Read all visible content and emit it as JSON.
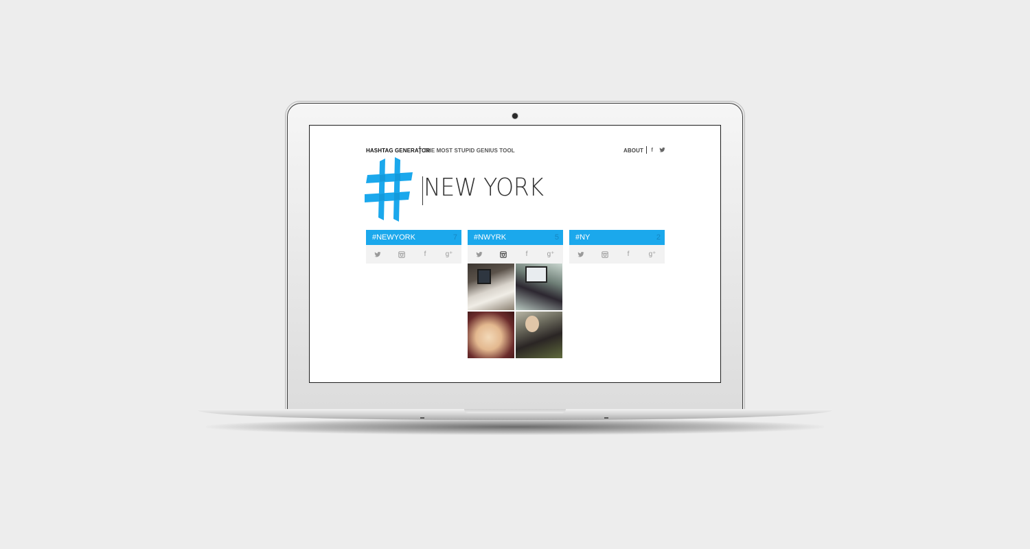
{
  "site": {
    "brand": "HASHTAG GENERATOR",
    "tagline": "THE MOST STUPID GENIUS TOOL",
    "nav": {
      "about": "ABOUT",
      "facebook_glyph": "f",
      "icons": [
        "facebook-icon",
        "twitter-icon"
      ]
    }
  },
  "search": {
    "query": "NEW YORK"
  },
  "colors": {
    "accent": "#1ba8ec",
    "count": "#1487c4",
    "icon_bar": "#f2f2f2"
  },
  "columns": [
    {
      "tag": "#NEWYORK",
      "count": "7",
      "active_icon": "none",
      "icons": [
        "twitter-icon",
        "instagram-icon",
        "facebook-icon",
        "google-plus-icon"
      ]
    },
    {
      "tag": "#NWYRK",
      "count": "5",
      "active_icon": "instagram-icon",
      "icons": [
        "twitter-icon",
        "instagram-icon",
        "facebook-icon",
        "google-plus-icon"
      ]
    },
    {
      "tag": "#NY",
      "count": "2",
      "active_icon": "none",
      "icons": [
        "twitter-icon",
        "instagram-icon",
        "facebook-icon",
        "google-plus-icon"
      ]
    }
  ],
  "icon_glyphs": {
    "facebook": "f",
    "google_plus": "g⁺"
  }
}
